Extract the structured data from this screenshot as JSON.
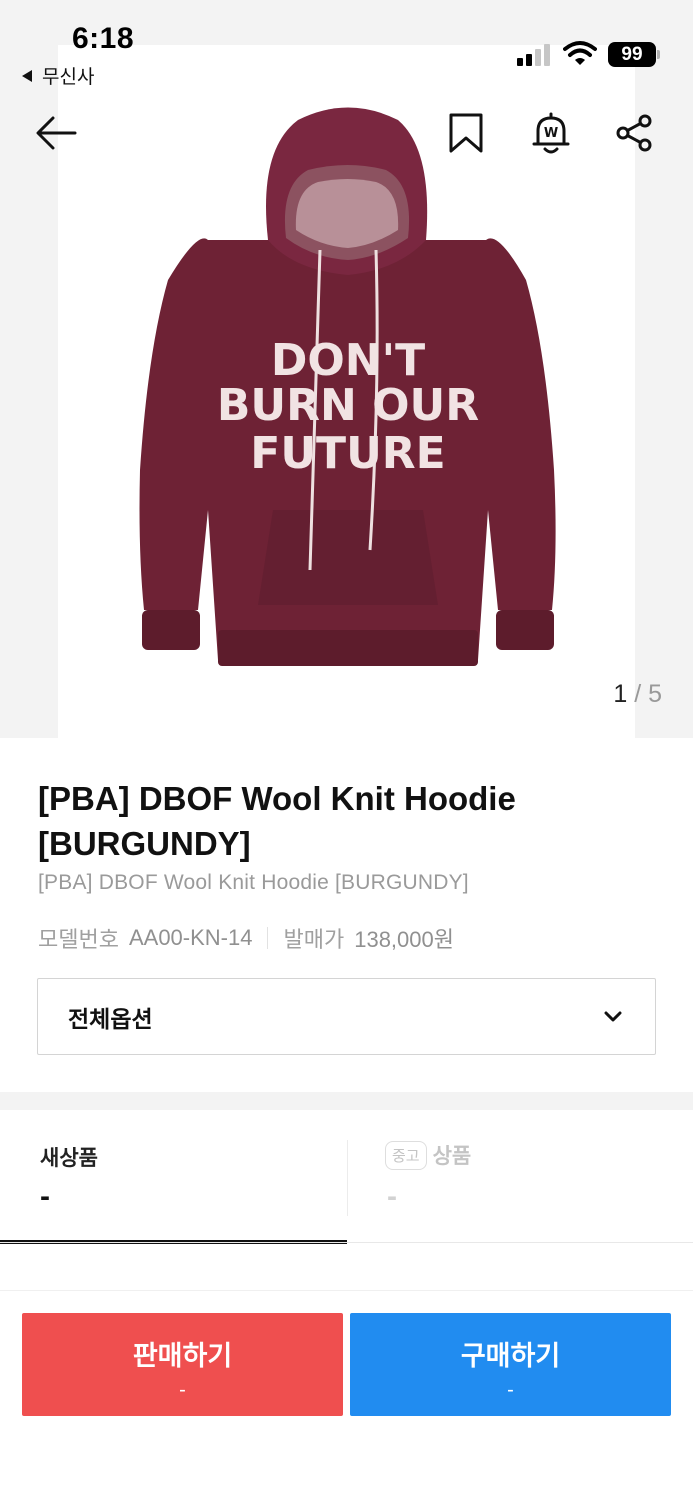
{
  "status_bar": {
    "time": "6:18",
    "back_app": "무신사",
    "battery": "99"
  },
  "nav": {
    "back_icon": "arrow-left-icon",
    "bookmark_icon": "bookmark-icon",
    "alarm_icon": "price-alert-bell-icon",
    "share_icon": "share-icon"
  },
  "gallery": {
    "current": "1",
    "separator": "/",
    "total": "5",
    "image": {
      "subject": "burgundy-knit-hoodie",
      "print_lines": [
        "DON'T",
        "BURN OUR",
        "FUTURE"
      ],
      "color": "#6e2235"
    }
  },
  "product": {
    "title": "[PBA] DBOF Wool Knit Hoodie [BURGUNDY]",
    "subtitle": "[PBA] DBOF Wool Knit Hoodie [BURGUNDY]",
    "model_label": "모델번호",
    "model_value": "AA00-KN-14",
    "release_label": "발매가",
    "release_value": "138,000원"
  },
  "option_select": {
    "label": "전체옵션",
    "icon": "chevron-down-icon"
  },
  "tabs": {
    "new": {
      "label": "새상품",
      "value": "-"
    },
    "used": {
      "badge": "중고",
      "label": "상품",
      "value": "-"
    }
  },
  "bottom": {
    "sell_label": "판매하기",
    "sell_sub": "-",
    "buy_label": "구매하기",
    "buy_sub": "-"
  },
  "colors": {
    "sell": "#ef4f4f",
    "buy": "#218cf0",
    "accent": "#111111"
  }
}
